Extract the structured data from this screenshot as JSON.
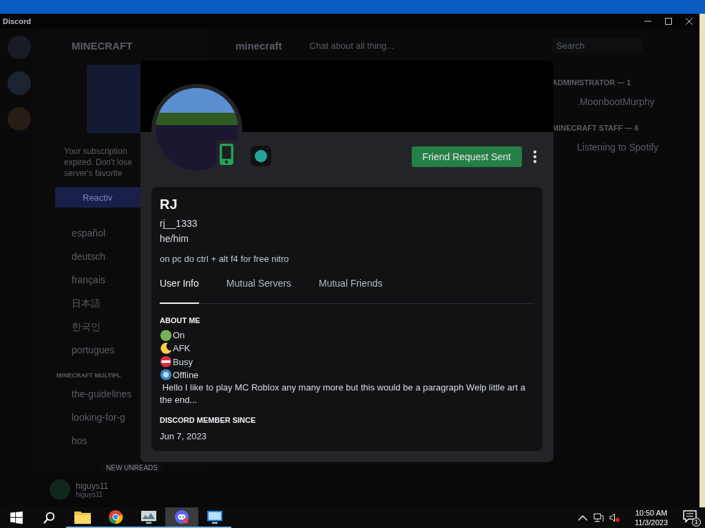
{
  "window": {
    "title": "Discord"
  },
  "server": {
    "name": "MINECRAFT"
  },
  "channel_header": {
    "name": "minecraft",
    "topic": "Chat about all thing...",
    "search_placeholder": "Search"
  },
  "promo": {
    "lines": [
      "Your subscription",
      "expired. Don't lose",
      "server's favorite"
    ],
    "button": "Reactiv"
  },
  "channels": [
    {
      "name": "español"
    },
    {
      "name": "deutsch"
    },
    {
      "name": "français"
    },
    {
      "name": "日本語"
    },
    {
      "name": "한국인"
    },
    {
      "name": "portugues"
    }
  ],
  "category": "MINECRAFT MULTIPL",
  "channels_2": [
    {
      "name": "the-guidelines"
    },
    {
      "name": "looking-for-g"
    },
    {
      "name": "hos"
    }
  ],
  "new_unreads": "NEW UNREADS",
  "current_user": {
    "name": "higuys11",
    "tag": "higuys11"
  },
  "members": [
    {
      "heading": "ADMINISTRATOR — 1",
      "names": [
        ".MoonbootMurphy"
      ]
    },
    {
      "heading": "MINECRAFT STAFF — 6",
      "names": [
        "Listening to Spotify"
      ]
    }
  ],
  "profile": {
    "display_name": "RJ",
    "username": "rj__1333",
    "pronouns": "he/him",
    "custom_status": "on pc do ctrl + alt f4 for free nitro",
    "button": "Friend Request Sent",
    "tabs": [
      {
        "label": "User Info",
        "selected": true
      },
      {
        "label": "Mutual Servers",
        "selected": false
      },
      {
        "label": "Mutual Friends",
        "selected": false
      }
    ],
    "about_title": "ABOUT ME",
    "status_lines": [
      {
        "kind": "online",
        "label": "On"
      },
      {
        "kind": "idle",
        "label": "AFK"
      },
      {
        "kind": "dnd",
        "label": "Busy"
      },
      {
        "kind": "offline",
        "label": "Offline"
      }
    ],
    "bio": " Hello I like to play MC Roblox any many more but this would be a paragraph Welp little art a the end...",
    "member_since_title": "DISCORD MEMBER SINCE",
    "member_since": "Jun 7, 2023"
  },
  "taskbar": {
    "apps": [
      {
        "kind": "explorer",
        "selected": false
      },
      {
        "kind": "chrome",
        "selected": false
      },
      {
        "kind": "monitor",
        "selected": false
      },
      {
        "kind": "discord",
        "selected": true
      },
      {
        "kind": "remote",
        "selected": false
      }
    ],
    "time": "10:50 AM",
    "date": "11/3/2023",
    "notifications": "1"
  }
}
